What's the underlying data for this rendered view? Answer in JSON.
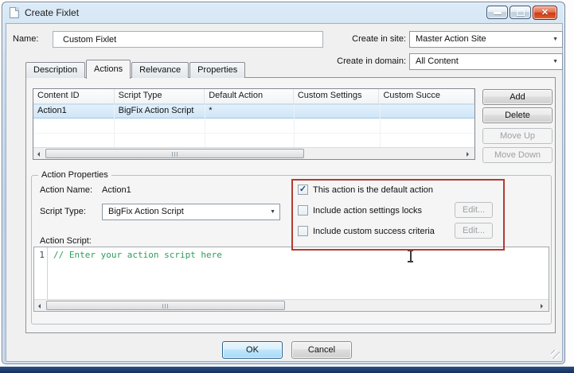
{
  "window": {
    "title": "Create Fixlet"
  },
  "icons": {
    "combo_arrow": "▼",
    "check": "✓",
    "close": "✕"
  },
  "header": {
    "name_label": "Name:",
    "name_value": "Custom Fixlet",
    "site_label": "Create in site:",
    "site_value": "Master Action Site",
    "domain_label": "Create in domain:",
    "domain_value": "All Content"
  },
  "tabs": {
    "items": [
      {
        "label": "Description"
      },
      {
        "label": "Actions"
      },
      {
        "label": "Relevance"
      },
      {
        "label": "Properties"
      }
    ]
  },
  "actions_table": {
    "columns": [
      "Content ID",
      "Script Type",
      "Default Action",
      "Custom Settings",
      "Custom Succe"
    ],
    "row": {
      "content_id": "Action1",
      "script_type": "BigFix Action Script",
      "default_action": "*",
      "custom_settings": "",
      "custom_success": ""
    },
    "buttons": {
      "add": "Add",
      "delete": "Delete",
      "move_up": "Move Up",
      "move_down": "Move Down"
    }
  },
  "action_properties": {
    "legend": "Action Properties",
    "action_name_label": "Action Name:",
    "action_name_value": "Action1",
    "script_type_label": "Script Type:",
    "script_type_value": "BigFix Action Script",
    "default_checkbox": {
      "label": "This action is the default action",
      "glyph": "✓"
    },
    "locks_checkbox": {
      "label": "Include action settings locks",
      "glyph": ""
    },
    "criteria_checkbox": {
      "label": "Include custom success criteria",
      "glyph": ""
    },
    "edit_locks_label": "Edit...",
    "edit_criteria_label": "Edit...",
    "action_script_label": "Action Script:"
  },
  "script_editor": {
    "line_number": "1",
    "code": "// Enter your action script here"
  },
  "footer": {
    "ok_label": "OK",
    "cancel_label": "Cancel"
  },
  "colors": {
    "code_green": "#2f9c5c",
    "highlight_red": "#b23b32",
    "selection_blue": "#cfe6f7",
    "titlebar_blue": "#c9dcee"
  }
}
